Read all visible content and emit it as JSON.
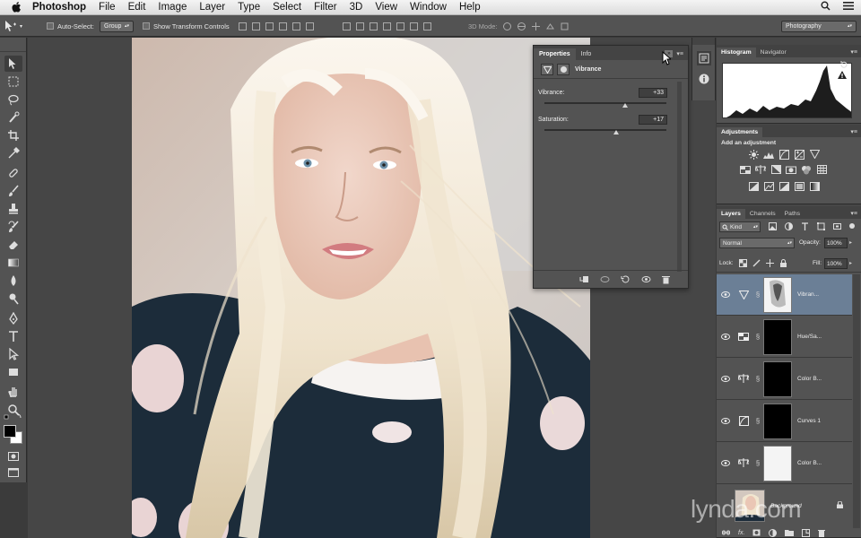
{
  "menubar": {
    "app": "Photoshop",
    "items": [
      "File",
      "Edit",
      "Image",
      "Layer",
      "Type",
      "Select",
      "Filter",
      "3D",
      "View",
      "Window",
      "Help"
    ]
  },
  "options_bar": {
    "auto_select_label": "Auto-Select:",
    "auto_select_value": "Group",
    "show_transform_label": "Show Transform Controls",
    "mode_3d_label": "3D Mode:",
    "workspace": "Photography"
  },
  "properties": {
    "tabs": [
      "Properties",
      "Info"
    ],
    "title": "Vibrance",
    "vibrance_label": "Vibrance:",
    "vibrance_value": "+33",
    "vibrance_level": 0.665,
    "saturation_label": "Saturation:",
    "saturation_value": "+17",
    "saturation_level": 0.585
  },
  "histogram": {
    "tabs": [
      "Histogram",
      "Navigator"
    ]
  },
  "adjustments": {
    "tab": "Adjustments",
    "add_label": "Add an adjustment"
  },
  "layers": {
    "tabs": [
      "Layers",
      "Channels",
      "Paths"
    ],
    "kind_label": "Kind",
    "blend_mode": "Normal",
    "opacity_label": "Opacity:",
    "opacity_value": "100%",
    "lock_label": "Lock:",
    "fill_label": "Fill:",
    "fill_value": "100%",
    "items": [
      {
        "name": "Vibran..."
      },
      {
        "name": "Hue/Sa..."
      },
      {
        "name": "Color B..."
      },
      {
        "name": "Curves 1"
      },
      {
        "name": "Color B..."
      },
      {
        "name": "Background"
      }
    ]
  },
  "watermark": "lynda.com",
  "colors": {
    "panel": "#535353",
    "selected_layer": "#6b7f96",
    "canvas": "#464646"
  }
}
